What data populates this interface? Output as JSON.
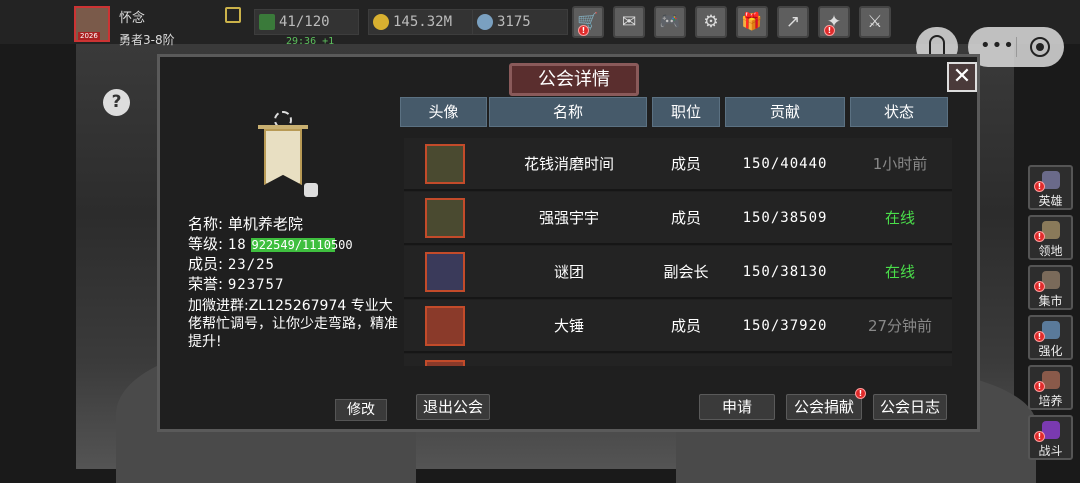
{
  "player": {
    "name": "怀念",
    "rank": "勇者3-8阶",
    "avatar_tag": "2026",
    "energy": "41/120",
    "energy_timer": "29:36 +1",
    "gold": "145.32M",
    "gems": "3175"
  },
  "toolbar": {
    "icons": [
      "shop-cart-icon",
      "mail-icon",
      "gamepad-icon",
      "gear-icon",
      "gift-icon",
      "share-icon",
      "event-icon",
      "battle-icon"
    ],
    "glyphs": [
      "🛒",
      "✉",
      "🎮",
      "⚙",
      "🎁",
      "↗",
      "✦",
      "⚔"
    ]
  },
  "side_menu": [
    {
      "label": "英雄",
      "color": "#6a6a8a"
    },
    {
      "label": "领地",
      "color": "#8a7a5a"
    },
    {
      "label": "集市",
      "color": "#7a6a5a"
    },
    {
      "label": "强化",
      "color": "#5a7a9a"
    },
    {
      "label": "培养",
      "color": "#8a5a4a"
    },
    {
      "label": "战斗",
      "color": "#7a3ab0"
    }
  ],
  "dialog": {
    "title": "公会详情",
    "close": "✕",
    "help": "?",
    "guild": {
      "name_label": "名称:",
      "name": "单机养老院",
      "level_label": "等级:",
      "level": "18",
      "exp_text": "922549/1110500",
      "exp_progress": 0.83,
      "members_label": "成员:",
      "members": "23/25",
      "honor_label": "荣誉:",
      "honor": "923757",
      "notice": "加微进群:ZL125267974 专业大佬帮忙调号，让你少走弯路，精准提升!",
      "edit_btn": "修改"
    },
    "table": {
      "headers": [
        "头像",
        "名称",
        "职位",
        "贡献",
        "状态"
      ],
      "rows": [
        {
          "name": "花钱消磨时间",
          "role": "成员",
          "contribution": "150/40440",
          "status": "1小时前",
          "online": false,
          "avatar_color": "#4a4a30"
        },
        {
          "name": "强强宇宇",
          "role": "成员",
          "contribution": "150/38509",
          "status": "在线",
          "online": true,
          "avatar_color": "#4a4a30"
        },
        {
          "name": "谜团",
          "role": "副会长",
          "contribution": "150/38130",
          "status": "在线",
          "online": true,
          "avatar_color": "#3a3a5a"
        },
        {
          "name": "大锤",
          "role": "成员",
          "contribution": "150/37920",
          "status": "27分钟前",
          "online": false,
          "avatar_color": "#8a3a2a"
        }
      ]
    },
    "buttons": {
      "leave": "退出公会",
      "apply": "申请",
      "donate": "公会捐献",
      "log": "公会日志"
    }
  }
}
